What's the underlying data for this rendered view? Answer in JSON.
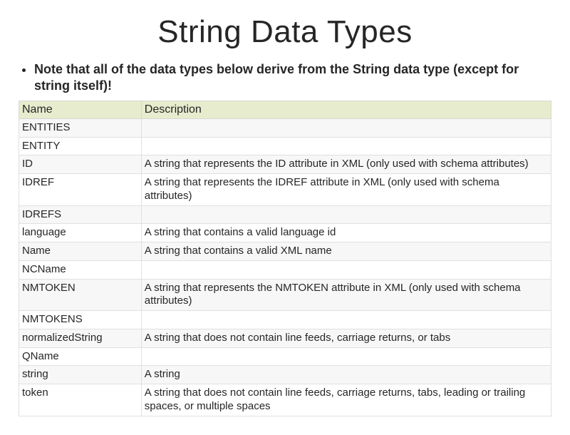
{
  "title": "String Data Types",
  "note": "Note that all of the data types below derive from the String data type (except for string itself)!",
  "table": {
    "headers": {
      "name": "Name",
      "description": "Description"
    },
    "rows": [
      {
        "name": "ENTITIES",
        "description": ""
      },
      {
        "name": "ENTITY",
        "description": ""
      },
      {
        "name": "ID",
        "description": "A string that represents the ID attribute in XML (only used with schema attributes)"
      },
      {
        "name": "IDREF",
        "description": "A string that represents the IDREF attribute in XML (only used with schema attributes)"
      },
      {
        "name": "IDREFS",
        "description": ""
      },
      {
        "name": "language",
        "description": "A string that contains a valid language id"
      },
      {
        "name": "Name",
        "description": "A string that contains a valid XML name"
      },
      {
        "name": "NCName",
        "description": ""
      },
      {
        "name": "NMTOKEN",
        "description": "A string that represents the NMTOKEN attribute in XML (only used with schema attributes)"
      },
      {
        "name": "NMTOKENS",
        "description": ""
      },
      {
        "name": "normalizedString",
        "description": "A string that does not contain line feeds, carriage returns, or tabs"
      },
      {
        "name": "QName",
        "description": ""
      },
      {
        "name": "string",
        "description": "A string"
      },
      {
        "name": "token",
        "description": "A string that does not contain line feeds, carriage returns, tabs, leading or trailing spaces, or multiple spaces"
      }
    ]
  }
}
